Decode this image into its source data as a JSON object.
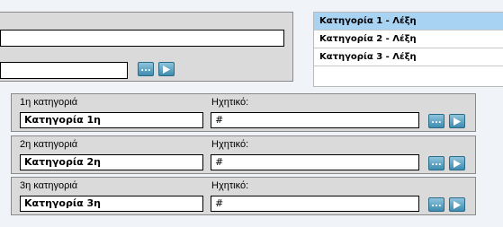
{
  "top": {
    "field1_value": "",
    "field2_value": "",
    "browse_label": "...",
    "play_icon": "play-icon"
  },
  "list": {
    "items": [
      {
        "label": "Κατηγορία 1 - Λέξη"
      },
      {
        "label": "Κατηγορία 2 - Λέξη"
      },
      {
        "label": "Κατηγορία 3 - Λέξη"
      }
    ],
    "selected_index": 0,
    "selected_color": "#a9d3f3"
  },
  "categories": [
    {
      "label": "1η κατηγοριά",
      "name_value": "Κατηγορία 1η",
      "sound_label": "Ηχητικό:",
      "sound_value": "#"
    },
    {
      "label": "2η κατηγοριά",
      "name_value": "Κατηγορία 2η",
      "sound_label": "Ηχητικό:",
      "sound_value": "#"
    },
    {
      "label": "3η κατηγοριά",
      "name_value": "Κατηγορία 3η",
      "sound_label": "Ηχητικό:",
      "sound_value": "#"
    }
  ],
  "colors": {
    "panel_bg": "#dadada",
    "button_gradient_top": "#8fc4dc",
    "button_gradient_bottom": "#3e8cb0",
    "page_bg": "#f0f4f8"
  }
}
